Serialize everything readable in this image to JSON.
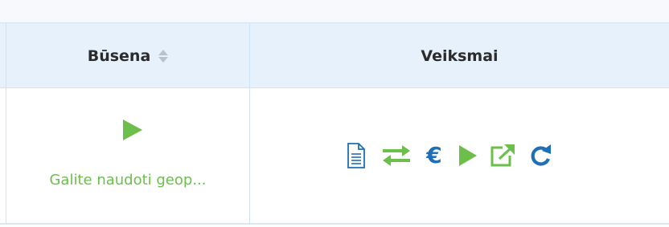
{
  "table": {
    "columns": {
      "status": {
        "label": "Būsena"
      },
      "actions": {
        "label": "Veiksmai"
      }
    },
    "row": {
      "status_text": "Galite naudoti geop..."
    }
  },
  "icons": {
    "sort": "sort-icon",
    "status_play": "play-icon",
    "actions": [
      "document-icon",
      "exchange-icon",
      "euro-icon",
      "play-icon",
      "external-link-icon",
      "refresh-icon"
    ]
  },
  "action_labels": {
    "euro": "€"
  },
  "colors": {
    "header_bg": "#e6f1fb",
    "border": "#cfe3f4",
    "green": "#6cbf4a",
    "blue": "#1f6fb5"
  }
}
